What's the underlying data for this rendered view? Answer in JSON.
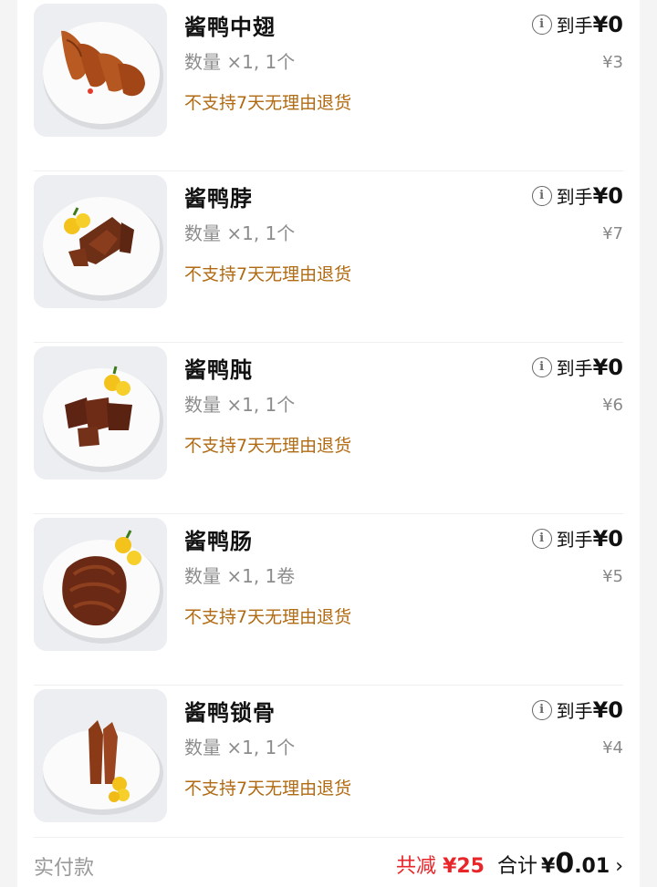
{
  "items": [
    {
      "name": "酱鸭中翅",
      "qty": "数量 ×1, 1个",
      "policy": "不支持7天无理由退货",
      "arrive_label": "到手",
      "arrive_value": "¥0",
      "original": "¥3",
      "photo": "duck-wings"
    },
    {
      "name": "酱鸭脖",
      "qty": "数量 ×1, 1个",
      "policy": "不支持7天无理由退货",
      "arrive_label": "到手",
      "arrive_value": "¥0",
      "original": "¥7",
      "photo": "duck-neck"
    },
    {
      "name": "酱鸭肫",
      "qty": "数量 ×1, 1个",
      "policy": "不支持7天无理由退货",
      "arrive_label": "到手",
      "arrive_value": "¥0",
      "original": "¥6",
      "photo": "duck-gizzard"
    },
    {
      "name": "酱鸭肠",
      "qty": "数量 ×1, 1卷",
      "policy": "不支持7天无理由退货",
      "arrive_label": "到手",
      "arrive_value": "¥0",
      "original": "¥5",
      "photo": "duck-intestine"
    },
    {
      "name": "酱鸭锁骨",
      "qty": "数量 ×1, 1个",
      "policy": "不支持7天无理由退货",
      "arrive_label": "到手",
      "arrive_value": "¥0",
      "original": "¥4",
      "photo": "duck-collarbone"
    }
  ],
  "footer": {
    "paid_label": "实付款",
    "discount_label": "共减",
    "discount_value": "¥25",
    "total_label": "合计",
    "total_symbol": "¥",
    "total_int": "0",
    "total_dec": ".01",
    "chevron": "›"
  },
  "colors": {
    "policy": "#b06a12",
    "discount": "#e8262a"
  }
}
